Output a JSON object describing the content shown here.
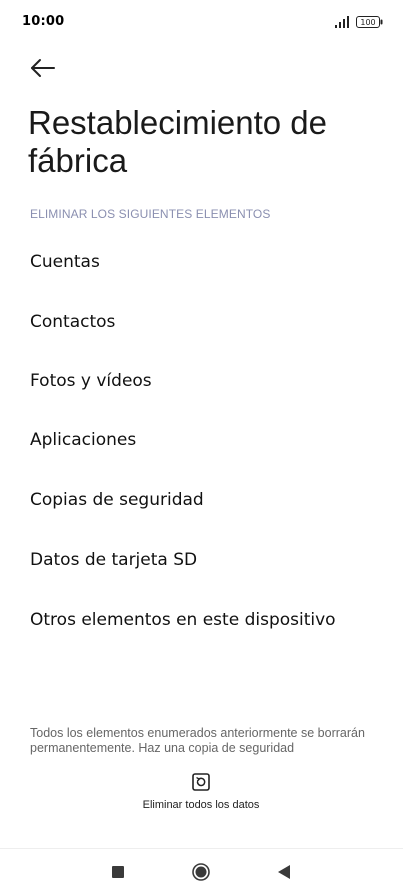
{
  "status_bar": {
    "time": "10:00",
    "battery_level": "100",
    "signal_icon": "signal-bars-icon",
    "battery_icon": "battery-icon"
  },
  "header": {
    "back_icon": "arrow-left-icon",
    "title": "Restablecimiento de fábrica"
  },
  "section": {
    "header": "ELIMINAR LOS SIGUIENTES ELEMENTOS",
    "items": [
      {
        "label": "Cuentas"
      },
      {
        "label": "Contactos"
      },
      {
        "label": "Fotos y vídeos"
      },
      {
        "label": "Aplicaciones"
      },
      {
        "label": "Copias de seguridad"
      },
      {
        "label": "Datos de tarjeta SD"
      },
      {
        "label": "Otros elementos en este dispositivo"
      }
    ]
  },
  "footer": {
    "note": "Todos los elementos enumerados anteriormente se borrarán permanentemente. Haz una copia de seguridad",
    "action_label": "Eliminar todos los datos",
    "action_icon": "reset-icon"
  },
  "nav_bar": {
    "recents_icon": "square-icon",
    "home_icon": "circle-icon",
    "back_icon": "triangle-back-icon"
  },
  "colors": {
    "background": "#ffffff",
    "section_header": "#8a8fb0",
    "text": "#111111",
    "footer_text": "#666666"
  }
}
